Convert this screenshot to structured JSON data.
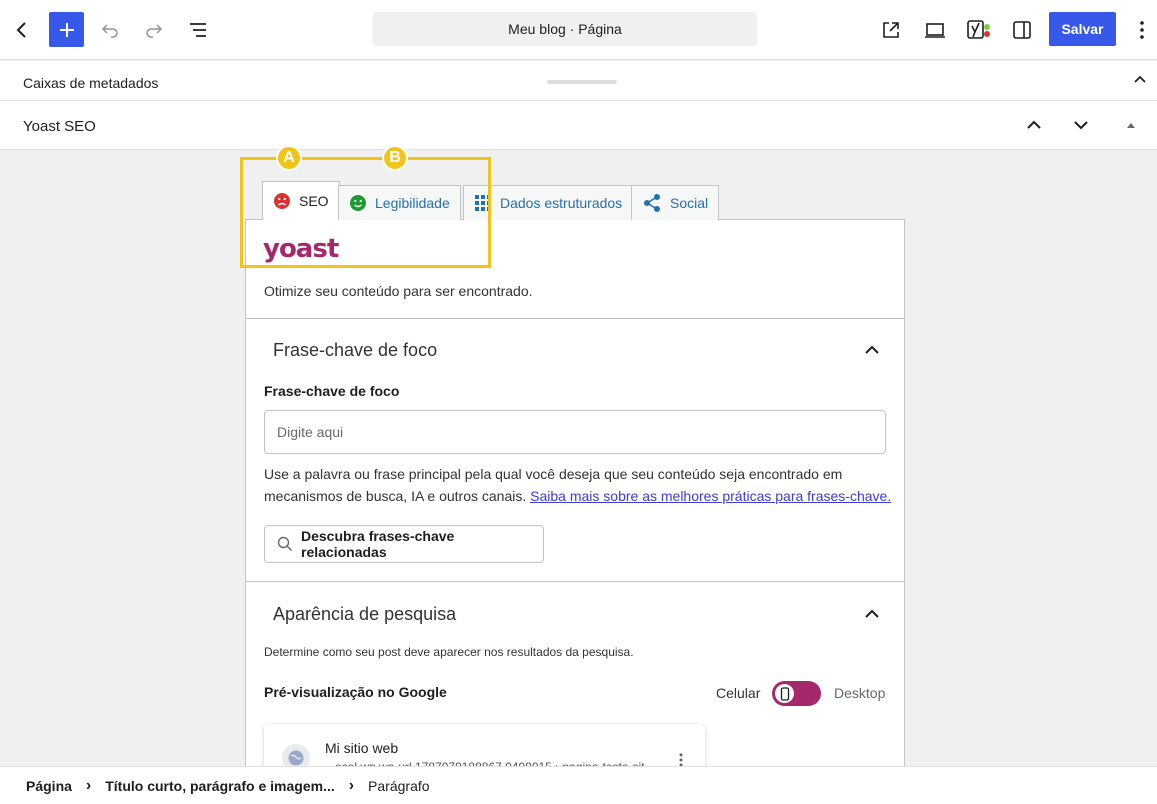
{
  "toolbar": {
    "doc_title": "Meu blog · Página",
    "save_label": "Salvar"
  },
  "metaboxes": {
    "label": "Caixas de metadados"
  },
  "yoast_box": {
    "label": "Yoast SEO"
  },
  "tabs": [
    {
      "label": "SEO",
      "icon": "sad-face-icon"
    },
    {
      "label": "Legibilidade",
      "icon": "smiley-icon"
    },
    {
      "label": "Dados estruturados",
      "icon": "grid-icon"
    },
    {
      "label": "Social",
      "icon": "share-icon"
    }
  ],
  "panel": {
    "logo": "yoast",
    "intro": "Otimize seu conteúdo para ser encontrado.",
    "focus": {
      "section_title": "Frase-chave de foco",
      "field_label": "Frase-chave de foco",
      "placeholder": "Digite aqui",
      "help": "Use a palavra ou frase principal pela qual você deseja que seu conteúdo seja encontrado em mecanismos de busca, IA e outros canais.",
      "help_link": "Saiba mais sobre as melhores práticas para frases-chave.",
      "discover_button": "Descubra frases-chave relacionadas"
    },
    "search": {
      "section_title": "Aparência de pesquisa",
      "description": "Determine como seu post deve aparecer nos resultados da pesquisa.",
      "preview_label": "Pré-visualização no Google",
      "mobile_label": "Celular",
      "desktop_label": "Desktop",
      "site_name": "Mi sitio web",
      "url": "...ocal.wp.wp-url 1787079188867 0498015 › pagina-teste-sit"
    }
  },
  "markers": {
    "a": "A",
    "b": "B"
  },
  "breadcrumb": [
    "Página",
    "Título curto, parágrafo e imagem...",
    "Parágrafo"
  ],
  "colors": {
    "accent": "#3858e9",
    "yoast": "#a4286a",
    "highlight": "#f0c419"
  }
}
